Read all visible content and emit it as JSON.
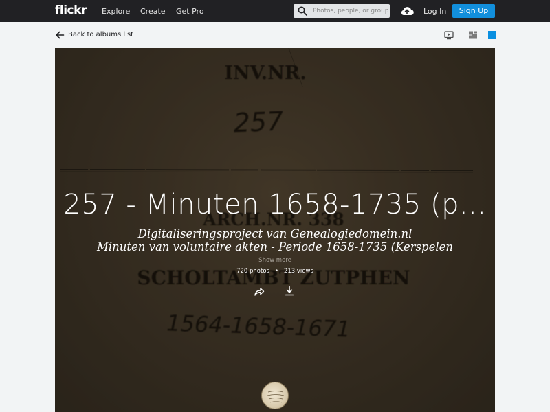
{
  "nav": {
    "logo": "flickr",
    "explore": "Explore",
    "create": "Create",
    "get_pro": "Get Pro",
    "search_placeholder": "Photos, people, or groups",
    "upload_icon": "cloud-upload-icon",
    "login": "Log In",
    "signup": "Sign Up",
    "signup_color": "#128fdc"
  },
  "subbar": {
    "back_label": "Back to albums list",
    "views": [
      "slideshow-icon",
      "grid-icon",
      "single-view-icon"
    ],
    "active_view_color": "#0a8fe0"
  },
  "cover": {
    "image_text": {
      "inv_label": "INV.NR.",
      "inv_number": "257",
      "arch_label": "ARCH.NR. 338",
      "institution": "SCHOLTAMBT ZUTPHEN",
      "years": "1564-1658-1671"
    }
  },
  "album": {
    "title": "257 - Minuten 1658-1735 (p...",
    "description_line1": "Digitaliseringsproject van Genealogiedomein.nl",
    "description_line2": "Minuten van voluntaire akten - Periode 1658-1735 (Kerspelen",
    "show_more": "Show more",
    "photos": "720 photos",
    "separator": "•",
    "views": "213 views",
    "share_icon": "share-arrow-icon",
    "download_icon": "download-icon",
    "avatar": "owner-avatar"
  }
}
